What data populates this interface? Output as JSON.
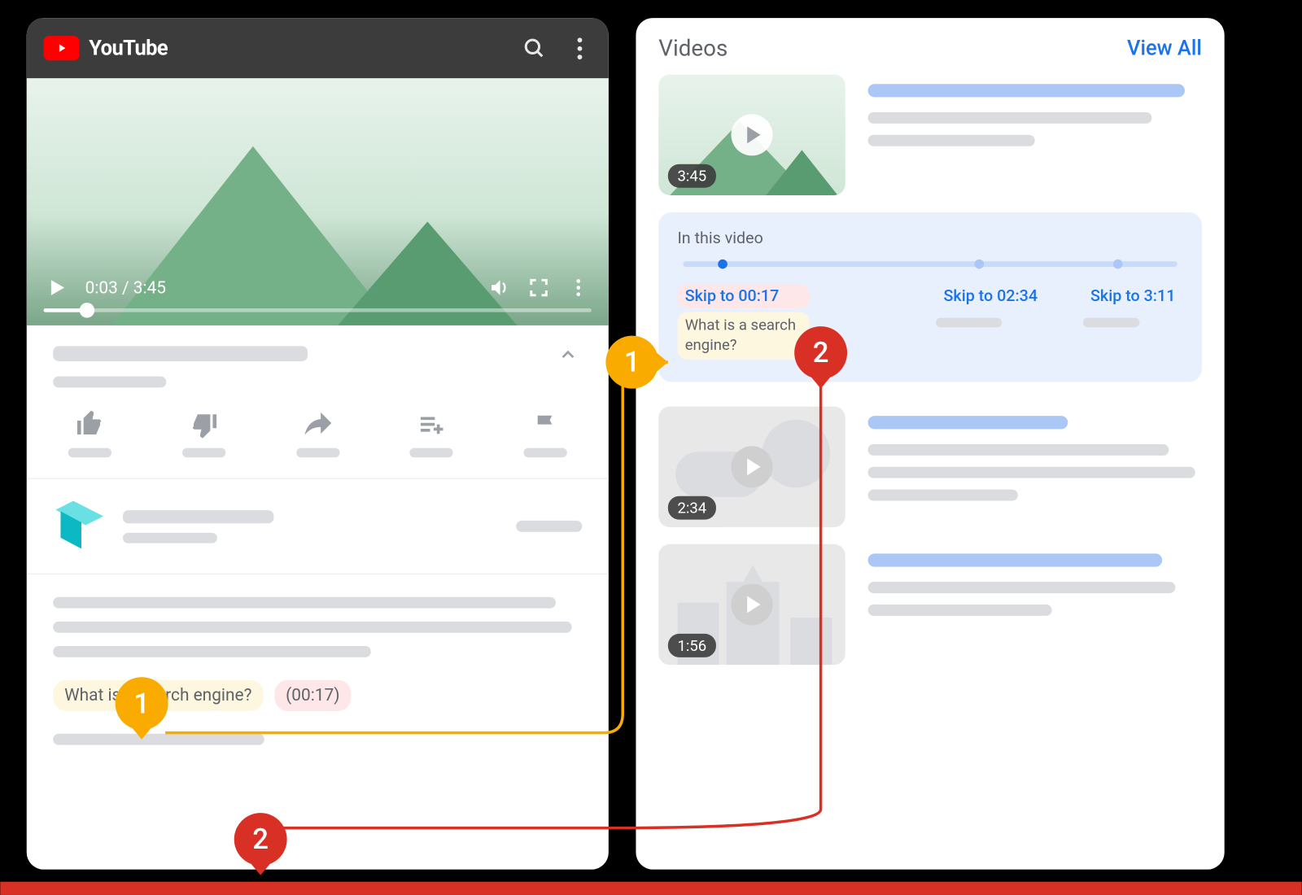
{
  "left": {
    "brand": "YouTube",
    "time_current": "0:03",
    "time_total": "3:45",
    "time_display": "0:03 / 3:45",
    "chapter_title": "What is a search engine?",
    "chapter_time": "(00:17)"
  },
  "right": {
    "title": "Videos",
    "view_all": "View All",
    "results": [
      {
        "duration": "3:45",
        "kind": "green"
      },
      {
        "duration": "2:34",
        "kind": "cloud"
      },
      {
        "duration": "1:56",
        "kind": "city"
      }
    ],
    "key_moments": {
      "label": "In this video",
      "moments": [
        {
          "skip": "Skip to 00:17",
          "chapter": "What is a search engine?",
          "highlighted": true,
          "pos": 8
        },
        {
          "skip": "Skip to 02:34",
          "highlighted": false,
          "pos": 60
        },
        {
          "skip": "Skip to 3:11",
          "highlighted": false,
          "pos": 88
        }
      ]
    }
  },
  "annotations": {
    "one": "1",
    "two": "2"
  }
}
